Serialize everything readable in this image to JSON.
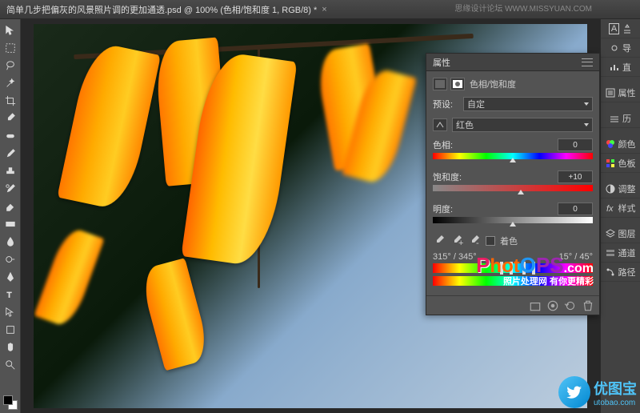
{
  "titlebar": {
    "filename": "简单几步把偏灰的风景照片调的更加通透.psd @ 100% (色相/饱和度 1, RGB/8) *",
    "close": "×"
  },
  "properties_panel": {
    "title": "属性",
    "adjustment_type": "色相/饱和度",
    "preset_label": "预设:",
    "preset_value": "自定",
    "channel_label": "",
    "channel_value": "红色",
    "hue_label": "色相:",
    "hue_value": "0",
    "saturation_label": "饱和度:",
    "saturation_value": "+10",
    "lightness_label": "明度:",
    "lightness_value": "0",
    "colorize_label": "着色",
    "angle_left1": "315°",
    "angle_left2": "345°",
    "angle_right1": "15°",
    "angle_right2": "45°"
  },
  "right_panels": {
    "r1a": "导",
    "r1b": "直",
    "r2": "属性",
    "r3": "历",
    "r4": "颜色",
    "r5": "色板",
    "r6": "调整",
    "r7": "样式",
    "r8": "图层",
    "r9": "通道",
    "r10": "路径"
  },
  "watermarks": {
    "top_right": "思缘设计论坛  WWW.MISSYUAN.COM",
    "photops_sub": "照片处理网 有你更精彩",
    "utobao_name": "优图宝",
    "utobao_url": "utobao.com"
  }
}
